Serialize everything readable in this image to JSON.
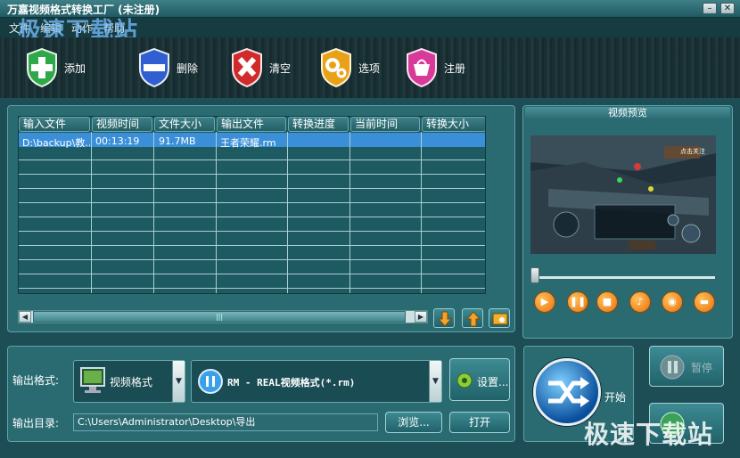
{
  "window": {
    "title": "万嘉视频格式转换工厂  (未注册)"
  },
  "watermark": {
    "top": "极速下载站",
    "bottom": "极速下载站"
  },
  "menu": [
    "文件",
    "编辑",
    "动作",
    "帮助"
  ],
  "toolbar": [
    {
      "label": "添加",
      "icon": "plus-shield-icon",
      "color": "#2fa84a"
    },
    {
      "label": "删除",
      "icon": "minus-shield-icon",
      "color": "#2f5fd0"
    },
    {
      "label": "清空",
      "icon": "x-shield-icon",
      "color": "#d22a2a"
    },
    {
      "label": "选项",
      "icon": "gear-shield-icon",
      "color": "#e8a21a"
    },
    {
      "label": "注册",
      "icon": "basket-shield-icon",
      "color": "#d83a9a"
    }
  ],
  "table": {
    "columns": [
      "输入文件",
      "视频时间",
      "文件大小",
      "输出文件",
      "转换进度",
      "当前时间",
      "转换大小"
    ],
    "rows": [
      {
        "input": "D:\\backup\\教...",
        "duration": "00:13:19",
        "size": "91.7MB",
        "output": "王者荣耀.rm",
        "progress": "",
        "current": "",
        "converted": ""
      }
    ]
  },
  "preview": {
    "title": "视频预览",
    "hud_text": "点击关注"
  },
  "player_buttons": [
    "play-icon",
    "pause-icon",
    "stop-icon",
    "volume-icon",
    "camera-icon",
    "folder-icon"
  ],
  "output": {
    "format_label": "输出格式:",
    "format_value": "视频格式",
    "profile_value": "RM - REAL视频格式(*.rm)",
    "settings_label": "设置...",
    "dir_label": "输出目录:",
    "dir_value": "C:\\Users\\Administrator\\Desktop\\导出",
    "browse_label": "浏览...",
    "open_label": "打开"
  },
  "actions": {
    "start_label": "开始",
    "pause_label": "暂停"
  }
}
